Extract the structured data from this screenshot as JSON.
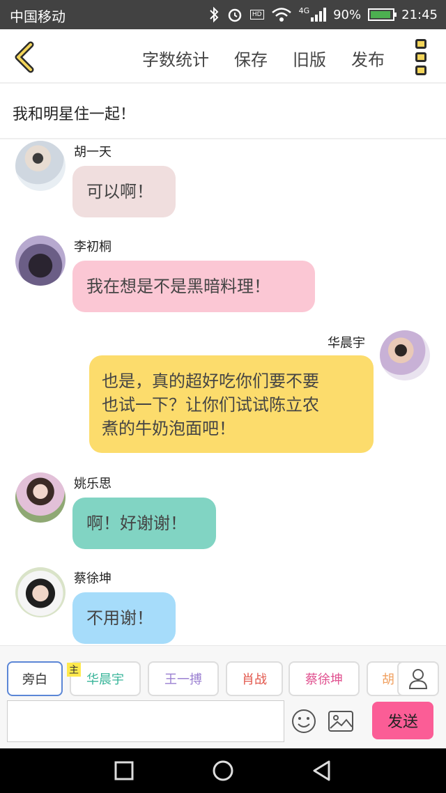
{
  "status_bar": {
    "carrier": "中国移动",
    "hd": "HD",
    "network": "4G",
    "battery": "90%",
    "time": "21:45"
  },
  "top_nav": {
    "actions": [
      "字数统计",
      "保存",
      "旧版",
      "发布"
    ]
  },
  "story": {
    "title": "我和明星住一起！"
  },
  "messages": [
    {
      "name": "胡一天",
      "text": "可以啊！",
      "side": "left",
      "color": "#f0dede"
    },
    {
      "name": "李初桐",
      "text": "我在想是不是黑暗料理！",
      "side": "left",
      "color": "#fbc7d4"
    },
    {
      "name": "华晨宇",
      "lines": [
        "也是，真的超好吃你们要不要",
        "也试一下？让你们试试陈立农",
        "煮的牛奶泡面吧！"
      ],
      "side": "right",
      "color": "#fcdc6c"
    },
    {
      "name": "姚乐思",
      "text": "啊！好谢谢！",
      "side": "left",
      "color": "#81d4c3"
    },
    {
      "name": "蔡徐坤",
      "text": "不用谢！",
      "side": "left",
      "color": "#a6dcfa"
    }
  ],
  "roles": {
    "narrator": "旁白",
    "host_tag": "主",
    "chips": [
      {
        "label": "华晨宇",
        "color": "#39b59a"
      },
      {
        "label": "王一搏",
        "color": "#9a7fd1"
      },
      {
        "label": "肖战",
        "color": "#e2574c"
      },
      {
        "label": "蔡徐坤",
        "color": "#e0508f"
      },
      {
        "label": "胡",
        "color": "#f0a060"
      }
    ]
  },
  "composer": {
    "input_value": "",
    "send_label": "发送"
  }
}
